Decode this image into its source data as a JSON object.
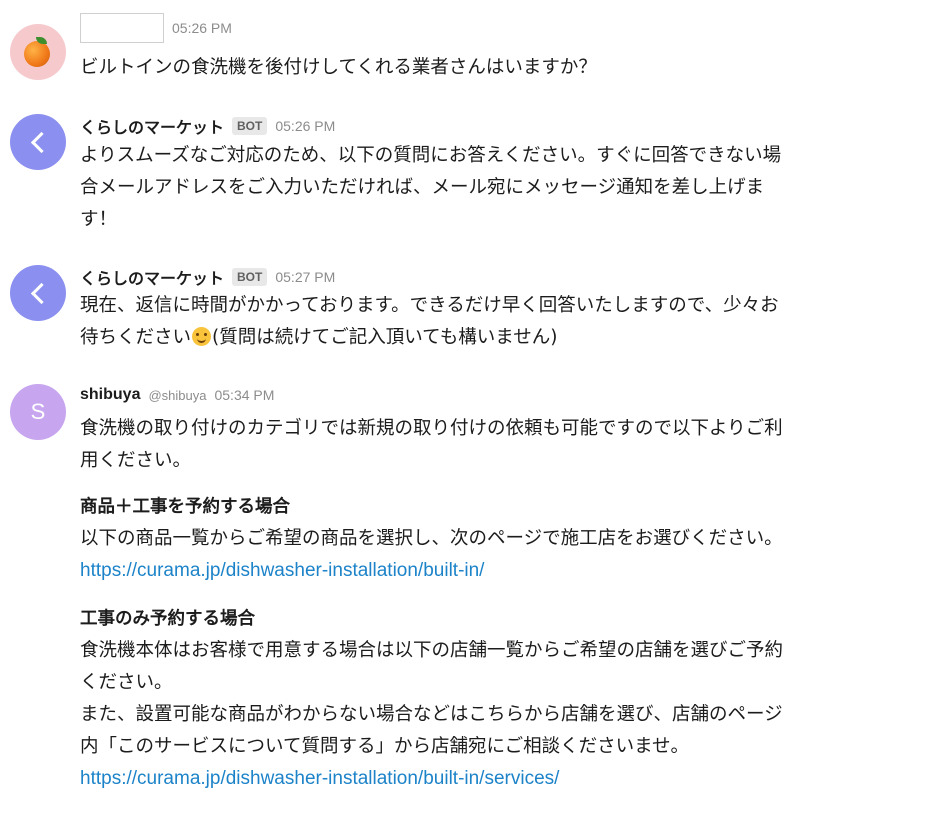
{
  "colors": {
    "link": "#1d83c9",
    "bot_avatar": "#8b90f0",
    "user_avatar": "#f6c9cd",
    "shibuya_avatar": "#c8a6ef"
  },
  "messages": [
    {
      "avatar_icon": "orange-icon",
      "author": "",
      "time": "05:26 PM",
      "lines": [
        "ビルトインの食洗機を後付けしてくれる業者さんはいますか？"
      ]
    },
    {
      "avatar_icon": "chevron-left-icon",
      "author": "くらしのマーケット",
      "badge": "BOT",
      "time": "05:26 PM",
      "lines": [
        "よりスムーズなご対応のため、以下の質問にお答えください。すぐに回答できない場",
        "合メールアドレスをご入力いただければ、メール宛にメッセージ通知を差し上げま",
        "す！"
      ]
    },
    {
      "avatar_icon": "chevron-left-icon",
      "author": "くらしのマーケット",
      "badge": "BOT",
      "time": "05:27 PM",
      "lines": [
        "現在、返信に時間がかかっております。できるだけ早く回答いたしますので、少々お",
        "待ちください",
        "(質問は続けてご記入頂いても構いません)"
      ]
    },
    {
      "avatar_letter": "S",
      "author": "shibuya",
      "handle": "@shibuya",
      "time": "05:34 PM",
      "lines": [
        "食洗機の取り付けのカテゴリでは新規の取り付けの依頼も可能ですので以下よりご利",
        "用ください。"
      ],
      "section1": {
        "heading": "商品＋工事を予約する場合",
        "text": "以下の商品一覧からご希望の商品を選択し、次のページで施工店をお選びください。",
        "link": "https://curama.jp/dishwasher-installation/built-in/"
      },
      "section2": {
        "heading": "工事のみ予約する場合",
        "lines": [
          "食洗機本体はお客様で用意する場合は以下の店舗一覧からご希望の店舗を選びご予約",
          "ください。",
          "また、設置可能な商品がわからない場合などはこちらから店舗を選び、店舗のページ",
          "内「このサービスについて質問する」から店舗宛にご相談くださいませ。"
        ],
        "link": "https://curama.jp/dishwasher-installation/built-in/services/"
      }
    }
  ]
}
